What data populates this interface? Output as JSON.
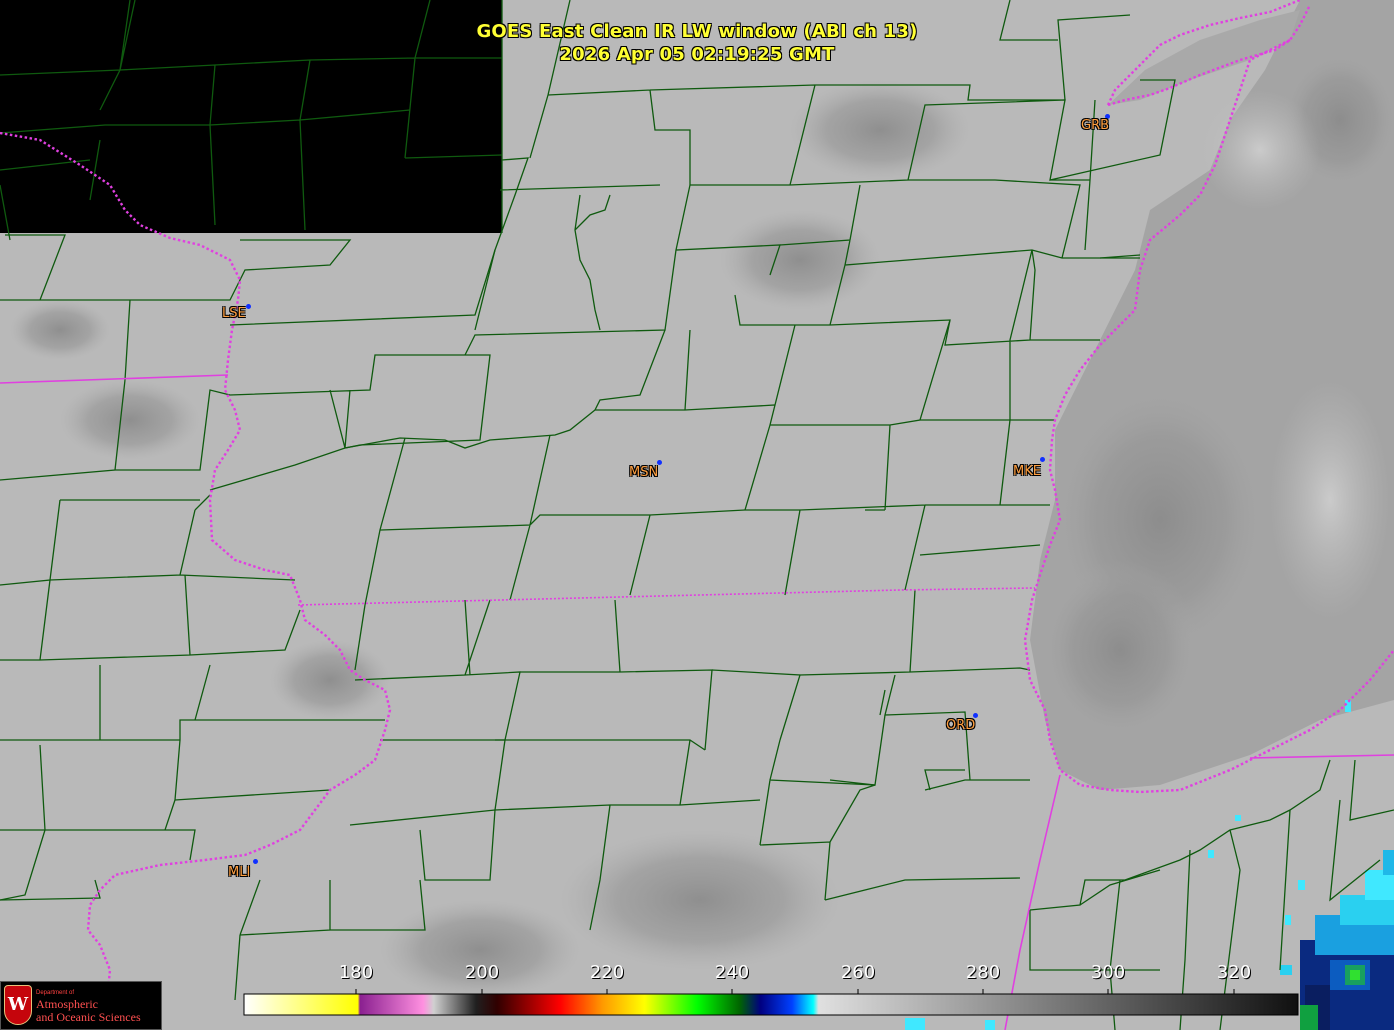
{
  "title_line1": "GOES East Clean IR LW window (ABI ch 13)",
  "title_line2": "2026 Apr 05  02:19:25 GMT",
  "cities": [
    {
      "code": "GRB"
    },
    {
      "code": "LSE"
    },
    {
      "code": "MSN"
    },
    {
      "code": "MKE"
    },
    {
      "code": "ORD"
    },
    {
      "code": "MLI"
    }
  ],
  "colorbar": {
    "ticks": [
      "180",
      "200",
      "220",
      "240",
      "260",
      "280",
      "300",
      "320"
    ],
    "colors": {
      "background_gray": "#b8b8b8",
      "county_lines": "#0f5a0f",
      "state_lines": "#e040e0",
      "no_data": "#000000",
      "title": "#ffff33",
      "city_label": "#ff9f40",
      "city_marker": "#1030ff"
    }
  },
  "logo": {
    "seal_letter": "W",
    "dept": "Department of",
    "line1": "Atmospheric",
    "line2": "and Oceanic Sciences"
  }
}
